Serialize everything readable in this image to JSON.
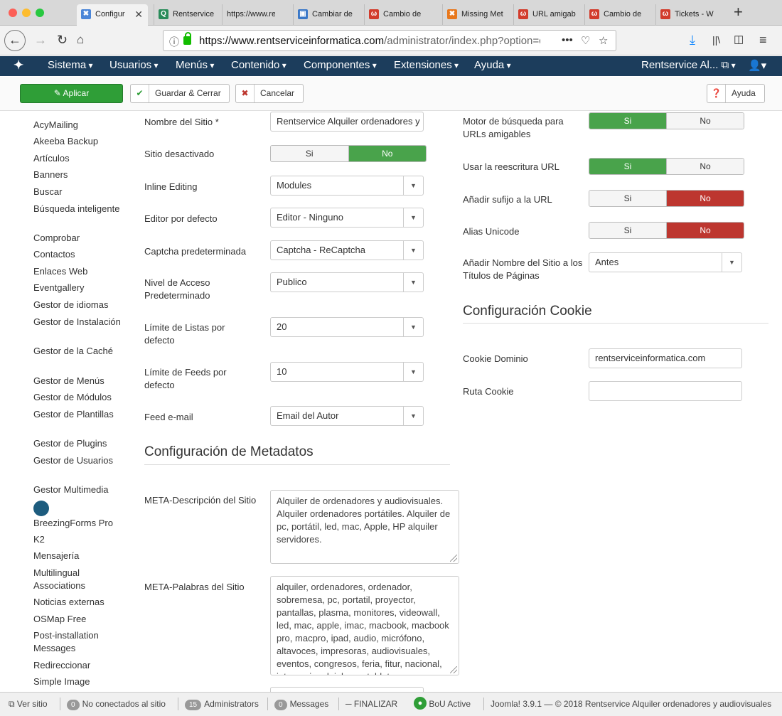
{
  "browser": {
    "tabs": [
      {
        "title": "Configur",
        "active": true,
        "fav": "#4b86d8",
        "glyph": "✖"
      },
      {
        "title": "Rentservice",
        "fav": "#2a8c5a",
        "glyph": "Q"
      },
      {
        "title": "https://www.ren"
      },
      {
        "title": "Cambiar de",
        "fav": "#3a78c8",
        "glyph": "▣"
      },
      {
        "title": "Cambio de",
        "fav": "#d23c2c",
        "glyph": "ω"
      },
      {
        "title": "Missing Met",
        "fav": "#e8781c",
        "glyph": "✖"
      },
      {
        "title": "URL amigab",
        "fav": "#d23c2c",
        "glyph": "ω"
      },
      {
        "title": "Cambio de",
        "fav": "#d23c2c",
        "glyph": "ω"
      },
      {
        "title": "Tickets - W",
        "fav": "#d23c2c",
        "glyph": "ω"
      }
    ],
    "url_domain": "https://www.rentserviceinformatica.com",
    "url_path": "/administrator/index.php?option=cc"
  },
  "menu": {
    "items": [
      "Sistema",
      "Usuarios",
      "Menús",
      "Contenido",
      "Componentes",
      "Extensiones",
      "Ayuda"
    ],
    "site": "Rentservice Al... ⧉"
  },
  "toolbar": {
    "apply": "Aplicar",
    "save_close": "Guardar & Cerrar",
    "cancel": "Cancelar",
    "help": "Ayuda"
  },
  "sidebar": [
    "AcyMailing",
    "Akeeba Backup",
    "Artículos",
    "Banners",
    "Buscar",
    "Búsqueda inteligente",
    "Comprobar",
    "Contactos",
    "Enlaces Web",
    "Eventgallery",
    "Gestor de idiomas",
    "Gestor de Instalación",
    "Gestor de la Caché",
    "Gestor de Menús",
    "Gestor de Módulos",
    "Gestor de Plantillas",
    "Gestor de Plugins",
    "Gestor de Usuarios",
    "Gestor Multimedia",
    "BreezingForms Pro",
    "K2",
    "Mensajería",
    "Multilingual Associations",
    "Noticias externas",
    "OSMap Free",
    "Post-installation Messages",
    "Redireccionar",
    "Simple Image"
  ],
  "form": {
    "site_name_label": "Nombre del Sitio *",
    "site_name_value": "Rentservice Alquiler ordenadores y",
    "offline_label": "Sitio desactivado",
    "inline_label": "Inline Editing",
    "inline_value": "Modules",
    "editor_label": "Editor por defecto",
    "editor_value": "Editor - Ninguno",
    "captcha_label": "Captcha predeterminada",
    "captcha_value": "Captcha - ReCaptcha",
    "access_label": "Nivel de Acceso Predeterminado",
    "access_value": "Publico",
    "list_label": "Límite de Listas por defecto",
    "list_value": "20",
    "feed_label": "Límite de Feeds por defecto",
    "feed_value": "10",
    "email_label": "Feed e-mail",
    "email_value": "Email del Autor",
    "meta_heading": "Configuración de Metadatos",
    "meta_desc_label": "META-Descripción del Sitio",
    "meta_desc_value": "Alquiler de ordenadores y audiovisuales. Alquiler ordenadores portátiles. Alquiler de pc, portátil, led, mac, Apple, HP alquiler servidores.",
    "meta_kw_label": "META-Palabras del Sitio",
    "meta_kw_value": "alquiler, ordenadores, ordenador, sobremesa, pc, portatil, proyector, pantallas, plasma, monitores, videowall, led, mac, apple, imac, macbook, macbook pro, macpro, ipad, audio, micrófono, altavoces, impresoras, audiovisuales, eventos, congresos, feria, fitur, nacional, internacional, iphone, tablet",
    "yes": "Si",
    "no": "No",
    "sef_label": "Motor de búsqueda para URLs amigables",
    "rewrite_label": "Usar la reescritura URL",
    "suffix_label": "Añadir sufijo a la URL",
    "unicode_label": "Alias Unicode",
    "sitename_pages_label": "Añadir Nombre del Sitio a los Títulos de Páginas",
    "sitename_pages_value": "Antes",
    "cookie_heading": "Configuración Cookie",
    "cookie_domain_label": "Cookie Dominio",
    "cookie_domain_value": "rentserviceinformatica.com",
    "cookie_path_label": "Ruta Cookie",
    "cookie_path_value": ""
  },
  "footer": {
    "view_site": "Ver sitio",
    "visitors_count": "0",
    "visitors": "No conectados al sitio",
    "admins_count": "15",
    "admins": "Administrators",
    "messages_count": "0",
    "messages": "Messages",
    "finalize": "FINALIZAR",
    "bou": "BoU Active",
    "version": "Joomla! 3.9.1 — © 2018 Rentservice Alquiler ordenadores y audiovisuales"
  }
}
